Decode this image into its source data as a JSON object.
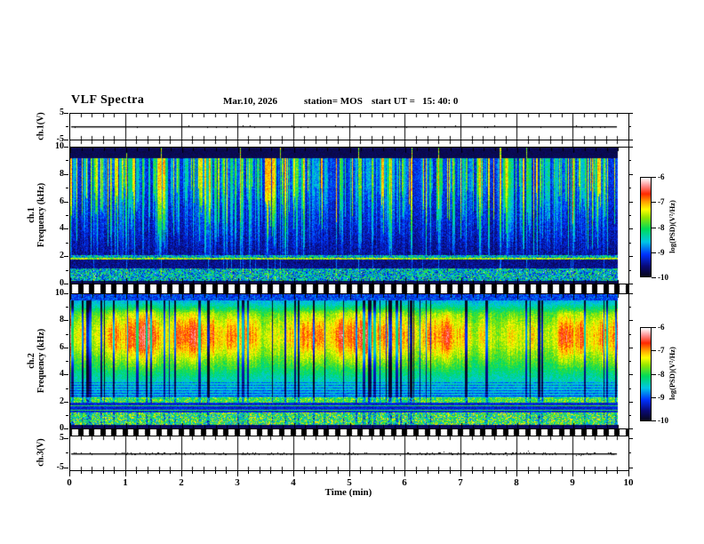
{
  "figure": {
    "title": "VLF Spectra",
    "date": "Mar.10, 2026",
    "station_label": "station= MOS",
    "start_label": "start UT =   15: 40: 0"
  },
  "panels": {
    "ch1_volt": {
      "label": "ch.1(V)"
    },
    "ch1_spec": {
      "label_line1": "ch.1",
      "label_line2": "Frequency (kHz)"
    },
    "ch2_spec": {
      "label_line1": "ch.2",
      "label_line2": "Frequency (kHz)"
    },
    "ch3_volt": {
      "label": "ch.3(V)"
    }
  },
  "axes": {
    "time_label": "Time (min)",
    "time_ticks": [
      "0",
      "1",
      "2",
      "3",
      "4",
      "5",
      "6",
      "7",
      "8",
      "9",
      "10"
    ],
    "freq_ticks": [
      "10",
      "8",
      "6",
      "4",
      "2",
      "0"
    ],
    "volt_ticks": [
      "5",
      "-5"
    ]
  },
  "colorbar": {
    "ticks": [
      "-6",
      "-7",
      "-8",
      "-9",
      "-10"
    ],
    "label": "log(PSD)(V²/Hz)"
  },
  "chart_data": {
    "type": "heatmap",
    "title": "VLF Spectra",
    "date": "Mar.10, 2026",
    "station": "MOS",
    "start_ut": "15: 40: 0",
    "x": {
      "label": "Time (min)",
      "range": [
        0,
        10
      ],
      "major_step": 1,
      "minor_step": 0.2,
      "data_extent": [
        0,
        9.8
      ]
    },
    "panels": [
      {
        "name": "ch.1(V)",
        "type": "line",
        "ylim": [
          -5,
          5
        ],
        "yticks": [
          5,
          -5
        ],
        "description": "flat voltage trace at ~0 V for the whole 10 minutes, tiny speckle noise"
      },
      {
        "name": "ch.1 spectrogram",
        "type": "heatmap",
        "ylabel": "Frequency (kHz)",
        "ylim": [
          0,
          10
        ],
        "yticks": [
          10,
          8,
          6,
          4,
          2,
          0
        ],
        "z_label": "log(PSD)(V²/Hz)",
        "z_range": [
          -10,
          -6
        ],
        "features": [
          {
            "band_khz": [
              9.25,
              10
            ],
            "level": -9.9,
            "description": "black band, no signal above ~9.3 kHz"
          },
          {
            "band_khz": [
              2.1,
              9.25
            ],
            "level_range": [
              -9.7,
              -7.0
            ],
            "description": "dense impulsive vertical streaks (sferics), blue/cyan background brightest near 7.5-9 kHz, darker toward 2-4 kHz, occasional yellow/red spikes"
          },
          {
            "band_khz": [
              1.75,
              2.1
            ],
            "level_range": [
              -9.3,
              -7.8
            ],
            "description": "bright speckled band with persistent horizontal line near 1.85 kHz"
          },
          {
            "band_khz": [
              1.15,
              1.75
            ],
            "level": -9.7,
            "description": "dark quiet band"
          },
          {
            "band_khz": [
              0.25,
              1.15
            ],
            "level_range": [
              -9.4,
              -7.7
            ],
            "description": "bright speckled hum band with rare red specks"
          },
          {
            "band_khz": [
              0,
              0.25
            ],
            "level": -9.9,
            "description": "dark edge"
          }
        ]
      },
      {
        "name": "ch.2 spectrogram",
        "type": "heatmap",
        "ylabel": "Frequency (kHz)",
        "ylim": [
          0,
          10
        ],
        "yticks": [
          10,
          8,
          6,
          4,
          2,
          0
        ],
        "z_label": "log(PSD)(V²/Hz)",
        "z_range": [
          -10,
          -6
        ],
        "features": [
          {
            "band_khz": [
              9.55,
              10
            ],
            "level": -9.3,
            "description": "dark blue speckled top edge"
          },
          {
            "band_khz": [
              4.5,
              9.55
            ],
            "level_range": [
              -8.3,
              -6.2
            ],
            "description": "strong broadband activity: green/yellow background with orange-red blobs clustered near 5.5-8.5 kHz, cut by dark blue vertical streaks"
          },
          {
            "band_khz": [
              2.35,
              4.5
            ],
            "level_range": [
              -8.8,
              -7.5
            ],
            "description": "cyan/green transition with horizontal striations"
          },
          {
            "band_khz": [
              1.95,
              2.35
            ],
            "level_range": [
              -8.6,
              -7.3
            ],
            "description": "green/yellow speckled band"
          },
          {
            "band_khz": [
              1.2,
              1.95
            ],
            "level": -9.4,
            "description": "dark blue band with bright horizontal lines near 1.4 and 1.7 kHz"
          },
          {
            "band_khz": [
              0.3,
              1.2
            ],
            "level_range": [
              -9.0,
              -7.1
            ],
            "description": "bright speckled hum band"
          },
          {
            "band_khz": [
              0,
              0.3
            ],
            "level": -9.85,
            "description": "dark edge"
          }
        ]
      },
      {
        "name": "ch.3(V)",
        "type": "line",
        "ylim": [
          -5,
          5
        ],
        "yticks": [
          5,
          -5
        ],
        "description": "near-constant voltage trace at ~0 V with small jitter noise"
      }
    ],
    "colormap": {
      "range": [
        -10,
        -6
      ],
      "stops": [
        [
          0.0,
          "#08081e"
        ],
        [
          0.1,
          "#0a0a78"
        ],
        [
          0.22,
          "#0032ff"
        ],
        [
          0.35,
          "#00c8e6"
        ],
        [
          0.48,
          "#00dc5a"
        ],
        [
          0.6,
          "#96e600"
        ],
        [
          0.68,
          "#ffff00"
        ],
        [
          0.76,
          "#ffa000"
        ],
        [
          0.84,
          "#ff2800"
        ],
        [
          0.92,
          "#ff8c8c"
        ],
        [
          1.0,
          "#ffffff"
        ]
      ]
    },
    "legend_position": "right colorbars, one per spectrogram, ticks -6 to -10"
  }
}
